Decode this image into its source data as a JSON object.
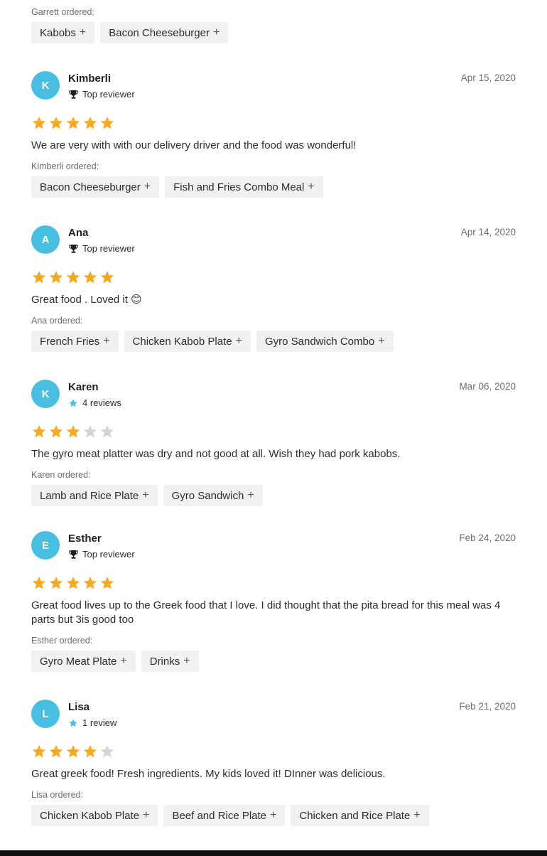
{
  "colors": {
    "star_filled": "#f6aa22",
    "star_empty": "#d5d5d5",
    "avatar_bg": "#48bfe0",
    "chip_bg": "#f1f1f3",
    "badge_star": "#48bfe0"
  },
  "top_order": {
    "label": "Garrett ordered:",
    "items": [
      "Kabobs",
      "Bacon Cheeseburger"
    ]
  },
  "reviews": [
    {
      "initial": "K",
      "name": "Kimberli",
      "badge_type": "trophy-icon",
      "badge_text": "Top reviewer",
      "date": "Apr 15, 2020",
      "rating": 5,
      "text": "We are very with with our delivery driver and the food was wonderful!",
      "ordered_label": "Kimberli ordered:",
      "items": [
        "Bacon Cheeseburger",
        "Fish and Fries Combo Meal"
      ]
    },
    {
      "initial": "A",
      "name": "Ana",
      "badge_type": "trophy-icon",
      "badge_text": "Top reviewer",
      "date": "Apr 14, 2020",
      "rating": 5,
      "text": "Great food . Loved it 😊",
      "ordered_label": "Ana ordered:",
      "items": [
        "French Fries",
        "Chicken Kabob Plate",
        "Gyro Sandwich Combo"
      ]
    },
    {
      "initial": "K",
      "name": "Karen",
      "badge_type": "star-icon",
      "badge_text": "4 reviews",
      "date": "Mar 06, 2020",
      "rating": 3,
      "text": "The gyro meat platter was dry and not good at all. Wish they had pork kabobs.",
      "ordered_label": "Karen ordered:",
      "items": [
        "Lamb and Rice Plate",
        "Gyro Sandwich"
      ]
    },
    {
      "initial": "E",
      "name": "Esther",
      "badge_type": "trophy-icon",
      "badge_text": "Top reviewer",
      "date": "Feb 24, 2020",
      "rating": 5,
      "text": "Great food lives up to the Greek food that I love. I did thought that the pita bread for this meal was 4 parts but 3is good too",
      "ordered_label": "Esther ordered:",
      "items": [
        "Gyro Meat Plate",
        "Drinks"
      ]
    },
    {
      "initial": "L",
      "name": "Lisa",
      "badge_type": "star-icon",
      "badge_text": "1 review",
      "date": "Feb 21, 2020",
      "rating": 4,
      "text": "Great greek food! Fresh ingredients. My kids loved it! DInner was delicious.",
      "ordered_label": "Lisa ordered:",
      "items": [
        "Chicken Kabob Plate",
        "Beef and Rice Plate",
        "Chicken and Rice Plate"
      ]
    }
  ]
}
